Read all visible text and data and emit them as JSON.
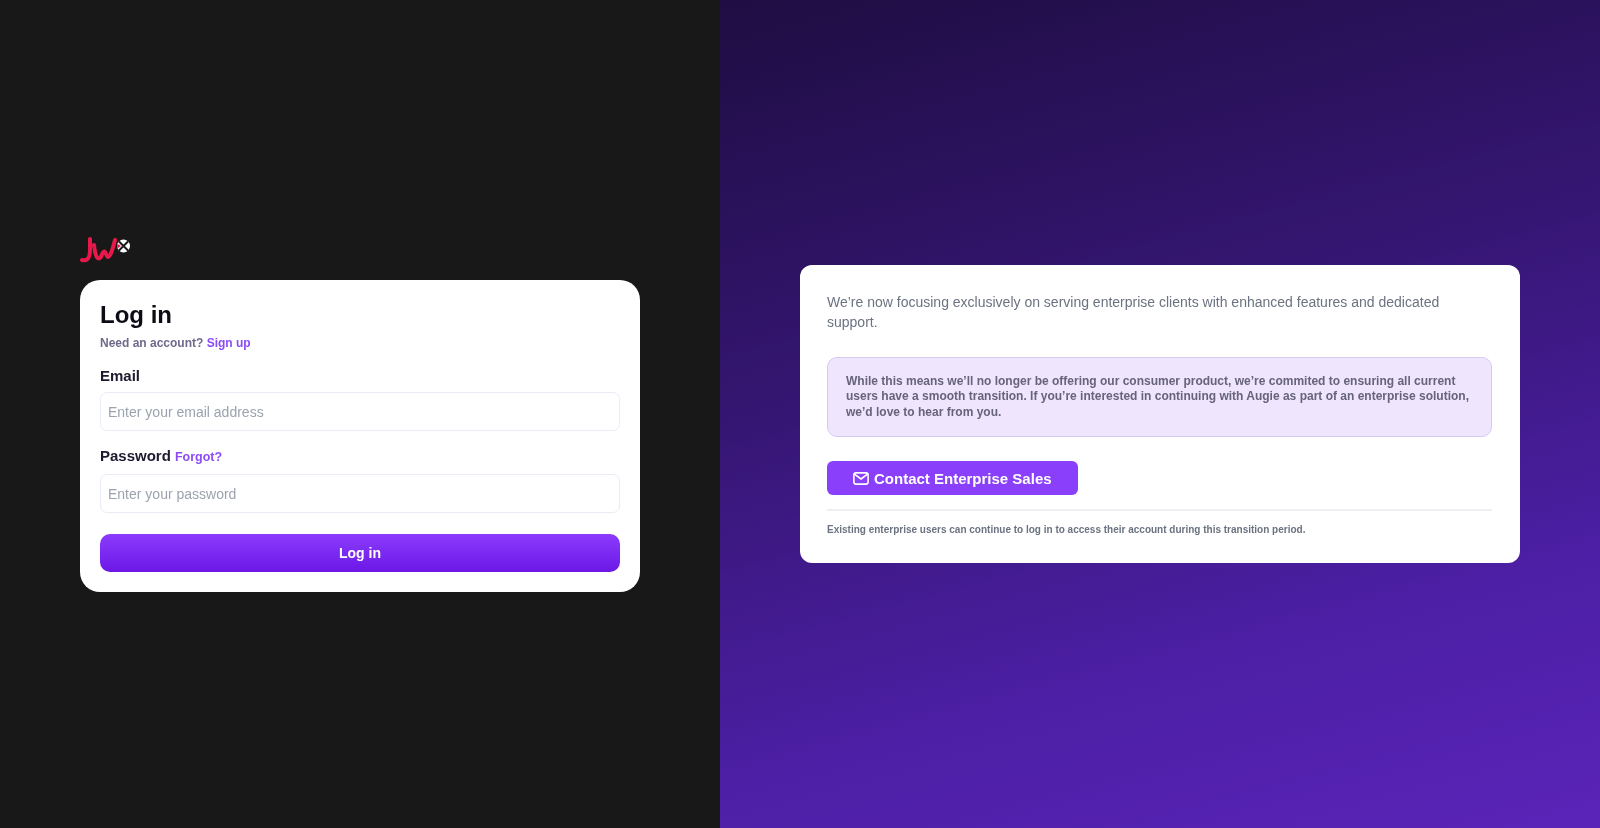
{
  "login": {
    "title": "Log in",
    "signup_prompt": "Need an account?",
    "signup_link": "Sign up",
    "fields": [
      {
        "label": "Email",
        "placeholder": "Enter your email address"
      },
      {
        "label": "Password",
        "link": "Forgot?",
        "placeholder": "Enter your password"
      }
    ],
    "submit_button": "Log in"
  },
  "notice": {
    "intro": "We’re now focusing exclusively on serving enterprise clients with enhanced features and dedicated support.",
    "callout": "While this means we’ll no longer be offering our consumer product, we’re commited to ensuring all current users have a smooth transition. If you’re interested in continuing with Augie as part of an enterprise solution, we’d love to hear from you.",
    "contact_button": "Contact Enterprise Sales",
    "footnote": "Existing enterprise users can continue to log in to access their account during this transition period."
  }
}
